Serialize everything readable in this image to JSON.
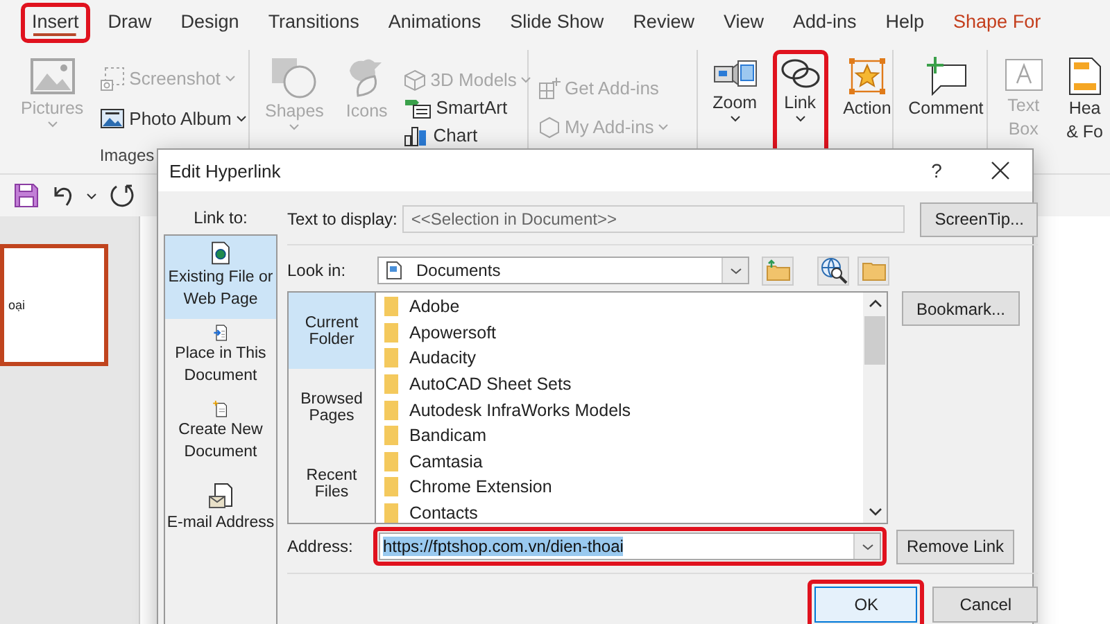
{
  "ribbon_tabs": [
    {
      "label": "Insert",
      "selected": true,
      "highlighted": true,
      "contextual": false
    },
    {
      "label": "Draw",
      "selected": false,
      "highlighted": false,
      "contextual": false
    },
    {
      "label": "Design",
      "selected": false,
      "highlighted": false,
      "contextual": false
    },
    {
      "label": "Transitions",
      "selected": false,
      "highlighted": false,
      "contextual": false
    },
    {
      "label": "Animations",
      "selected": false,
      "highlighted": false,
      "contextual": false
    },
    {
      "label": "Slide Show",
      "selected": false,
      "highlighted": false,
      "contextual": false
    },
    {
      "label": "Review",
      "selected": false,
      "highlighted": false,
      "contextual": false
    },
    {
      "label": "View",
      "selected": false,
      "highlighted": false,
      "contextual": false
    },
    {
      "label": "Add-ins",
      "selected": false,
      "highlighted": false,
      "contextual": false
    },
    {
      "label": "Help",
      "selected": false,
      "highlighted": false,
      "contextual": false
    },
    {
      "label": "Shape For",
      "selected": false,
      "highlighted": false,
      "contextual": true
    }
  ],
  "ribbon": {
    "pictures": {
      "label": "Pictures",
      "disabled": true
    },
    "screenshot": {
      "label": "Screenshot",
      "disabled": true
    },
    "photo_album": {
      "label": "Photo Album",
      "disabled": false
    },
    "images_group": "Images",
    "shapes": {
      "label": "Shapes",
      "disabled": true
    },
    "icons": {
      "label": "Icons",
      "disabled": true
    },
    "models_3d": {
      "label": "3D Models",
      "disabled": true
    },
    "smartart": {
      "label": "SmartArt",
      "disabled": false
    },
    "chart": {
      "label": "Chart",
      "disabled": false
    },
    "get_addins": {
      "label": "Get Add-ins",
      "disabled": true
    },
    "my_addins": {
      "label": "My Add-ins",
      "disabled": true
    },
    "zoom": {
      "label": "Zoom",
      "disabled": false
    },
    "link": {
      "label": "Link",
      "disabled": false,
      "highlighted": true
    },
    "action": {
      "label": "Action",
      "disabled": false
    },
    "comment": {
      "label": "Comment",
      "disabled": false
    },
    "text_box": {
      "lines": [
        "Text",
        "Box"
      ],
      "disabled": true
    },
    "header_footer": {
      "lines": [
        "Hea",
        "& Fo"
      ],
      "disabled": false
    }
  },
  "slide_thumbnail": {
    "text": "oại",
    "selected": true
  },
  "dialog": {
    "title": "Edit Hyperlink",
    "help": "?",
    "link_to": {
      "label": "Link to:",
      "items": [
        {
          "label": "Existing File or Web Page",
          "selected": true
        },
        {
          "label": "Place in This Document",
          "selected": false
        },
        {
          "label": "Create New Document",
          "selected": false
        },
        {
          "label": "E-mail Address",
          "selected": false
        }
      ]
    },
    "text_to_display": {
      "label": "Text to display:",
      "value": "<<Selection in Document>>",
      "disabled": true
    },
    "screentip_button": "ScreenTip...",
    "look_in": {
      "label": "Look in:",
      "value": "Documents"
    },
    "sources": [
      {
        "label": "Current Folder",
        "selected": true
      },
      {
        "label": "Browsed Pages",
        "selected": false
      },
      {
        "label": "Recent Files",
        "selected": false
      }
    ],
    "files": [
      "Adobe",
      "Apowersoft",
      "Audacity",
      "AutoCAD Sheet Sets",
      "Autodesk InfraWorks Models",
      "Bandicam",
      "Camtasia",
      "Chrome Extension",
      "Contacts"
    ],
    "bookmark_button": "Bookmark...",
    "address": {
      "label": "Address:",
      "value": "https://fptshop.com.vn/dien-thoai",
      "text_selected": true,
      "highlighted": true
    },
    "remove_link_button": "Remove Link",
    "ok_button": {
      "label": "OK",
      "highlighted": true
    },
    "cancel_button": "Cancel"
  }
}
